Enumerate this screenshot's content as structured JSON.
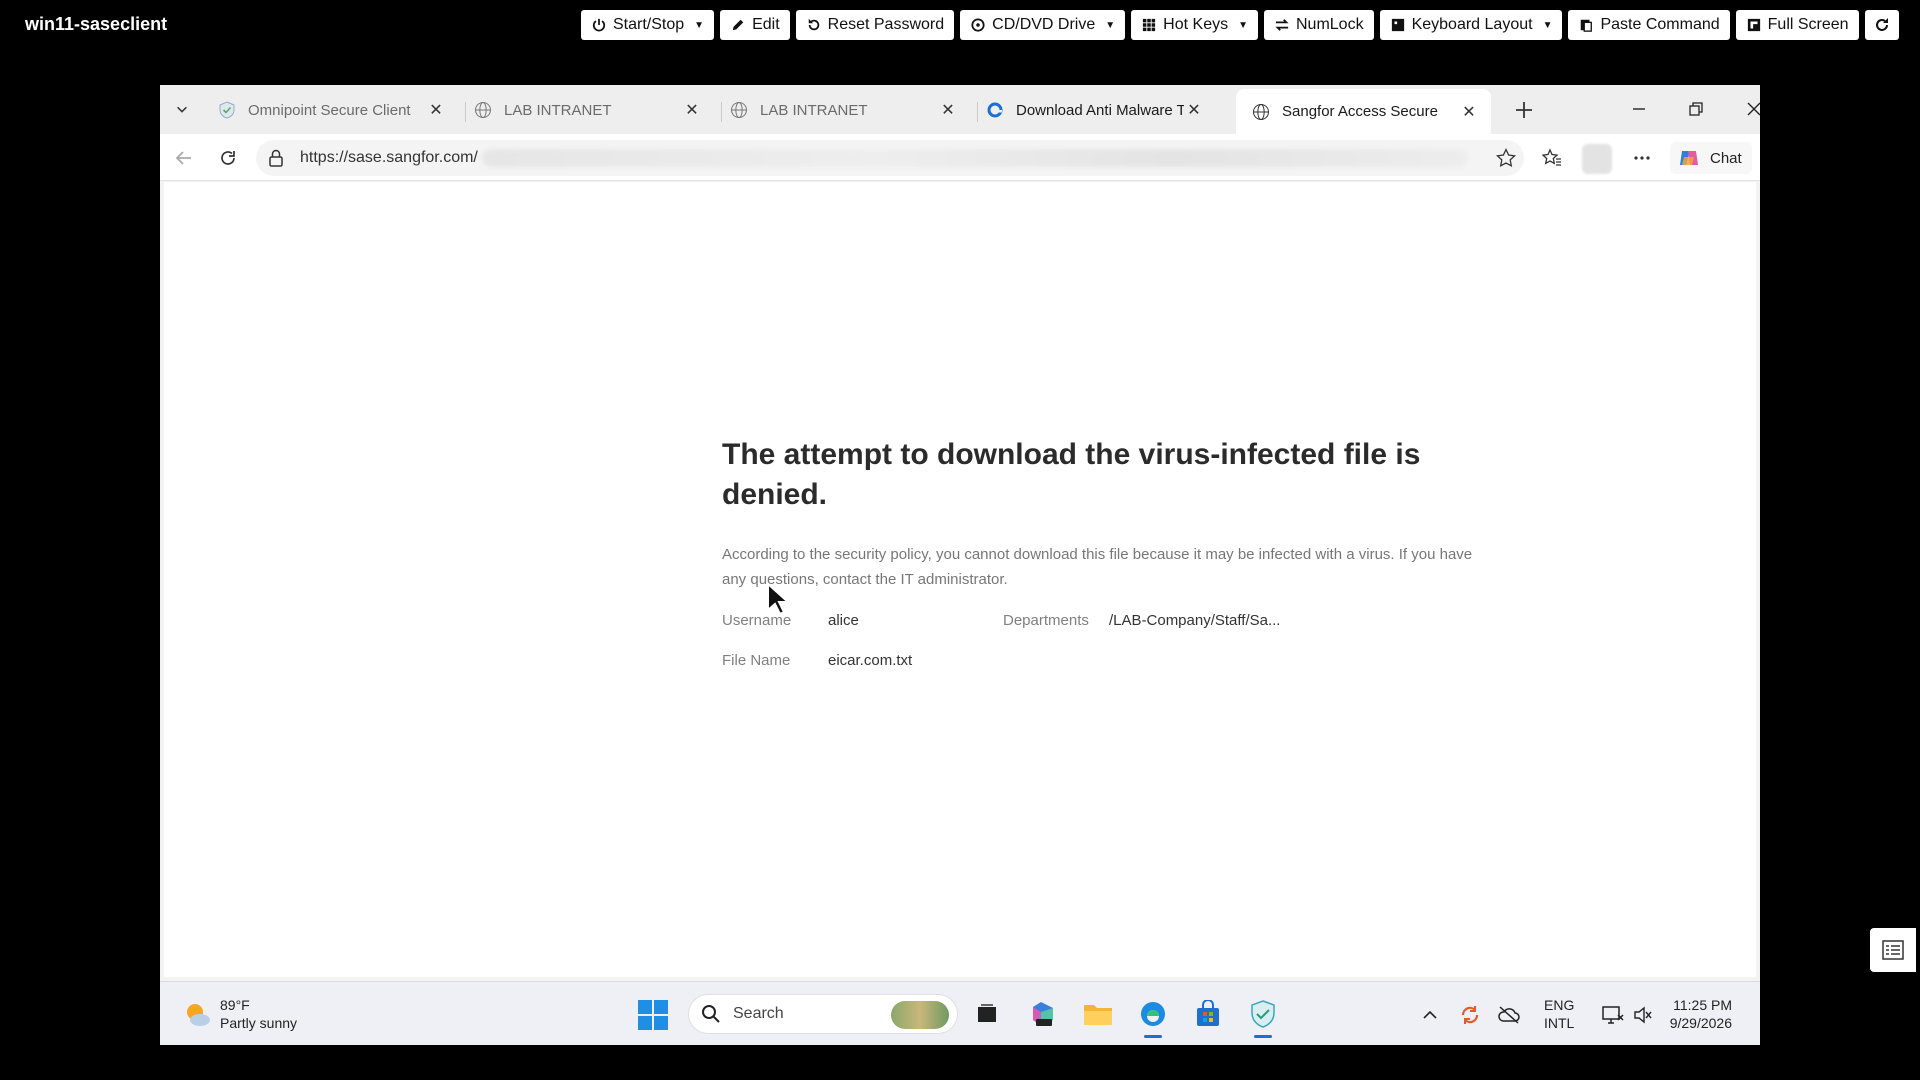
{
  "console": {
    "title": "win11-saseclient",
    "buttons": [
      {
        "label": "Start/Stop",
        "icon": "power-icon"
      },
      {
        "label": "Edit",
        "icon": "pencil-icon"
      },
      {
        "label": "Reset Password",
        "icon": "reset-icon"
      },
      {
        "label": "CD/DVD Drive",
        "icon": "disc-icon"
      },
      {
        "label": "Hot Keys",
        "icon": "grid-icon"
      },
      {
        "label": "NumLock",
        "icon": "swap-icon"
      },
      {
        "label": "Keyboard Layout",
        "icon": "keyboard-icon"
      },
      {
        "label": "Paste Command",
        "icon": "paste-icon"
      },
      {
        "label": "Full Screen",
        "icon": "fullscreen-icon"
      }
    ]
  },
  "browser": {
    "tabs": [
      {
        "label": "Omnipoint Secure Client"
      },
      {
        "label": "LAB INTRANET"
      },
      {
        "label": "LAB INTRANET"
      },
      {
        "label": "Download Anti Malware Tes"
      },
      {
        "label": "Sangfor Access Secure"
      }
    ],
    "url": "https://sase.sangfor.com/",
    "chat_label": "Chat"
  },
  "page": {
    "headline": "The attempt to download the virus-infected file is denied.",
    "description": "According to the security policy, you cannot download this file because it may be infected with a virus. If you have any questions, contact the IT administrator.",
    "username_label": "Username",
    "username_value": "alice",
    "departments_label": "Departments",
    "departments_value": "/LAB-Company/Staff/Sa...",
    "filename_label": "File Name",
    "filename_value": "eicar.com.txt"
  },
  "taskbar": {
    "temperature": "89°F",
    "weather": "Partly sunny",
    "search_placeholder": "Search",
    "lang_top": "ENG",
    "lang_bottom": "INTL",
    "time": "11:25 PM",
    "date": "9/29/2026"
  },
  "colors": {
    "accent": "#1a6fd6",
    "windows_blue": "#1f8fe6",
    "headline": "#2b2b2b"
  }
}
